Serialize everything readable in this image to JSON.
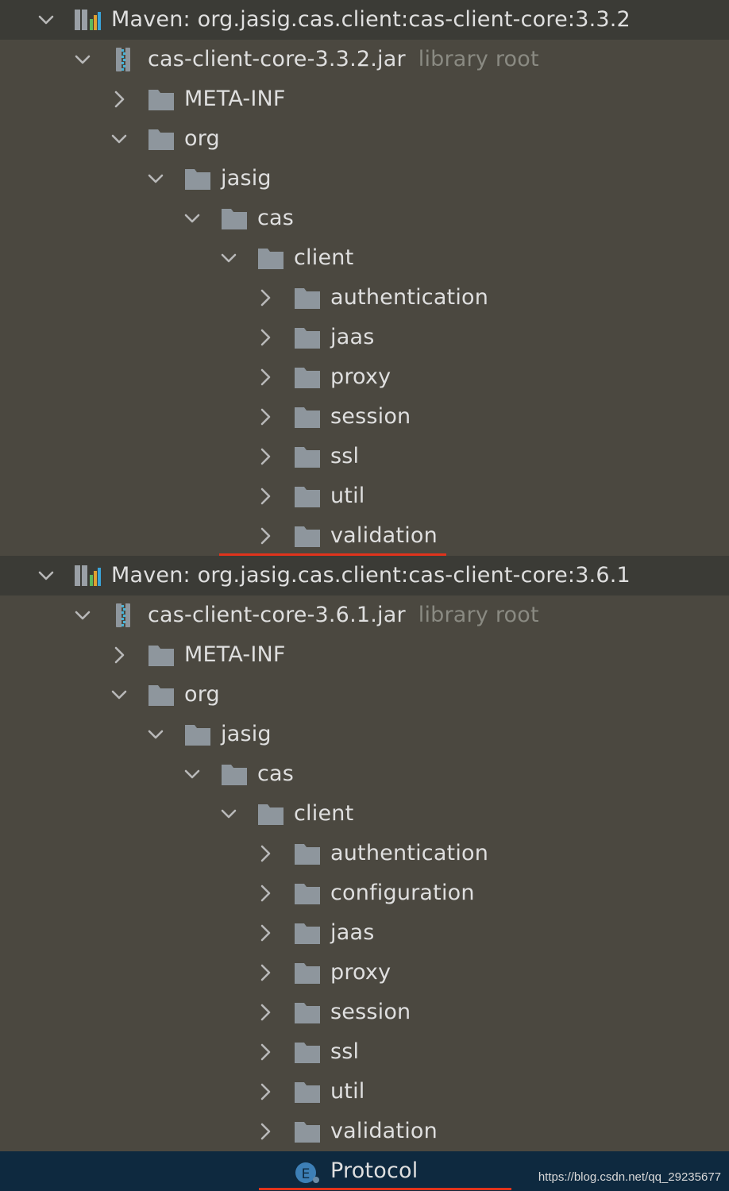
{
  "tree": [
    {
      "label": "Maven: org.jasig.cas.client:cas-client-core:3.3.2",
      "depth": 0,
      "expanded": true,
      "icon": "maven-library-icon",
      "kind": "header"
    },
    {
      "label": "cas-client-core-3.3.2.jar",
      "hint": "library root",
      "depth": 1,
      "expanded": true,
      "icon": "jar-archive-icon"
    },
    {
      "label": "META-INF",
      "depth": 2,
      "expanded": false,
      "icon": "folder-icon"
    },
    {
      "label": "org",
      "depth": 2,
      "expanded": true,
      "icon": "folder-icon"
    },
    {
      "label": "jasig",
      "depth": 3,
      "expanded": true,
      "icon": "folder-icon"
    },
    {
      "label": "cas",
      "depth": 4,
      "expanded": true,
      "icon": "folder-icon"
    },
    {
      "label": "client",
      "depth": 5,
      "expanded": true,
      "icon": "folder-icon"
    },
    {
      "label": "authentication",
      "depth": 6,
      "expanded": false,
      "icon": "folder-icon"
    },
    {
      "label": "jaas",
      "depth": 6,
      "expanded": false,
      "icon": "folder-icon"
    },
    {
      "label": "proxy",
      "depth": 6,
      "expanded": false,
      "icon": "folder-icon"
    },
    {
      "label": "session",
      "depth": 6,
      "expanded": false,
      "icon": "folder-icon"
    },
    {
      "label": "ssl",
      "depth": 6,
      "expanded": false,
      "icon": "folder-icon"
    },
    {
      "label": "util",
      "depth": 6,
      "expanded": false,
      "icon": "folder-icon"
    },
    {
      "label": "validation",
      "depth": 6,
      "expanded": false,
      "icon": "folder-icon",
      "underline": true
    },
    {
      "label": "Maven: org.jasig.cas.client:cas-client-core:3.6.1",
      "depth": 0,
      "expanded": true,
      "icon": "maven-library-icon",
      "kind": "header"
    },
    {
      "label": "cas-client-core-3.6.1.jar",
      "hint": "library root",
      "depth": 1,
      "expanded": true,
      "icon": "jar-archive-icon"
    },
    {
      "label": "META-INF",
      "depth": 2,
      "expanded": false,
      "icon": "folder-icon"
    },
    {
      "label": "org",
      "depth": 2,
      "expanded": true,
      "icon": "folder-icon"
    },
    {
      "label": "jasig",
      "depth": 3,
      "expanded": true,
      "icon": "folder-icon"
    },
    {
      "label": "cas",
      "depth": 4,
      "expanded": true,
      "icon": "folder-icon"
    },
    {
      "label": "client",
      "depth": 5,
      "expanded": true,
      "icon": "folder-icon"
    },
    {
      "label": "authentication",
      "depth": 6,
      "expanded": false,
      "icon": "folder-icon"
    },
    {
      "label": "configuration",
      "depth": 6,
      "expanded": false,
      "icon": "folder-icon"
    },
    {
      "label": "jaas",
      "depth": 6,
      "expanded": false,
      "icon": "folder-icon"
    },
    {
      "label": "proxy",
      "depth": 6,
      "expanded": false,
      "icon": "folder-icon"
    },
    {
      "label": "session",
      "depth": 6,
      "expanded": false,
      "icon": "folder-icon"
    },
    {
      "label": "ssl",
      "depth": 6,
      "expanded": false,
      "icon": "folder-icon"
    },
    {
      "label": "util",
      "depth": 6,
      "expanded": false,
      "icon": "folder-icon"
    },
    {
      "label": "validation",
      "depth": 6,
      "expanded": false,
      "icon": "folder-icon"
    },
    {
      "label": "Protocol",
      "depth": 6,
      "leaf": true,
      "icon": "enum-class-icon",
      "selected": true,
      "underline": true
    }
  ],
  "watermark": "https://blog.csdn.net/qq_29235677",
  "colors": {
    "background": "#4b4840",
    "header_background": "#3b3b36",
    "selected_background": "#0e293f",
    "folder": "#8e969d",
    "underline": "#e0331c",
    "text": "#dfdfdf",
    "hint_text": "#8a8a82"
  }
}
